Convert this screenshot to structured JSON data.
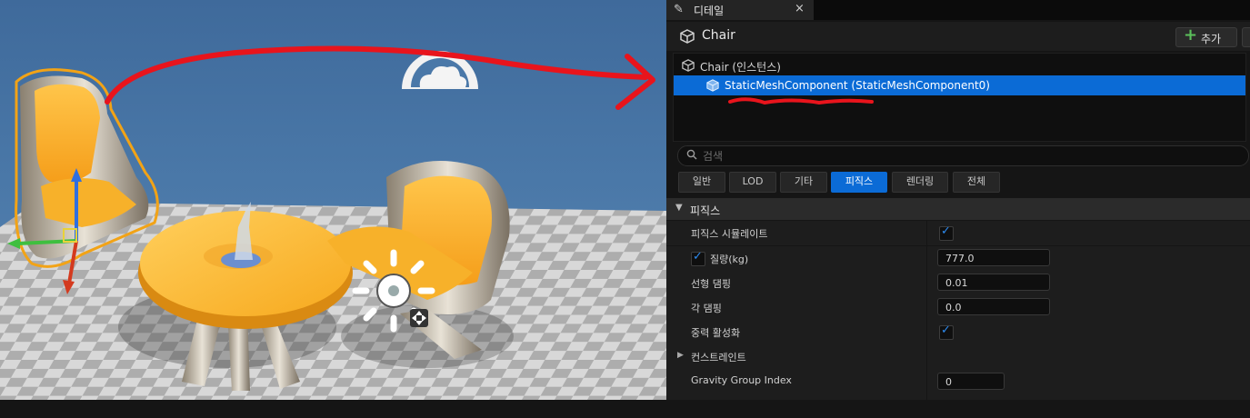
{
  "panel": {
    "tab_label": "디테일",
    "close_glyph": "×",
    "actor_name": "Chair",
    "add_label": "추가",
    "components": [
      {
        "label": "Chair (인스턴스)"
      },
      {
        "label": "StaticMeshComponent (StaticMeshComponent0)",
        "selected": true
      }
    ],
    "search_placeholder": "검색",
    "filters": [
      "일반",
      "LOD",
      "기타",
      "피직스",
      "렌더링",
      "전체"
    ],
    "active_filter": "피직스",
    "category": "피직스",
    "properties": [
      {
        "name": "피직스 시뮬레이트",
        "type": "checkbox",
        "checked": true
      },
      {
        "name": "질량(kg)",
        "type": "number",
        "value": "777.0",
        "override_checked": true
      },
      {
        "name": "선형 댐핑",
        "type": "number",
        "value": "0.01"
      },
      {
        "name": "각 댐핑",
        "type": "number",
        "value": "0.0"
      },
      {
        "name": "중력 활성화",
        "type": "checkbox",
        "checked": true
      },
      {
        "name": "컨스트레인트",
        "type": "group"
      },
      {
        "name": "Gravity Group Index",
        "type": "number",
        "value": "0"
      }
    ]
  },
  "colors": {
    "selection_blue": "#0b6bd6",
    "annotation_red": "#e8141c",
    "check_blue": "#2e8bf0"
  }
}
